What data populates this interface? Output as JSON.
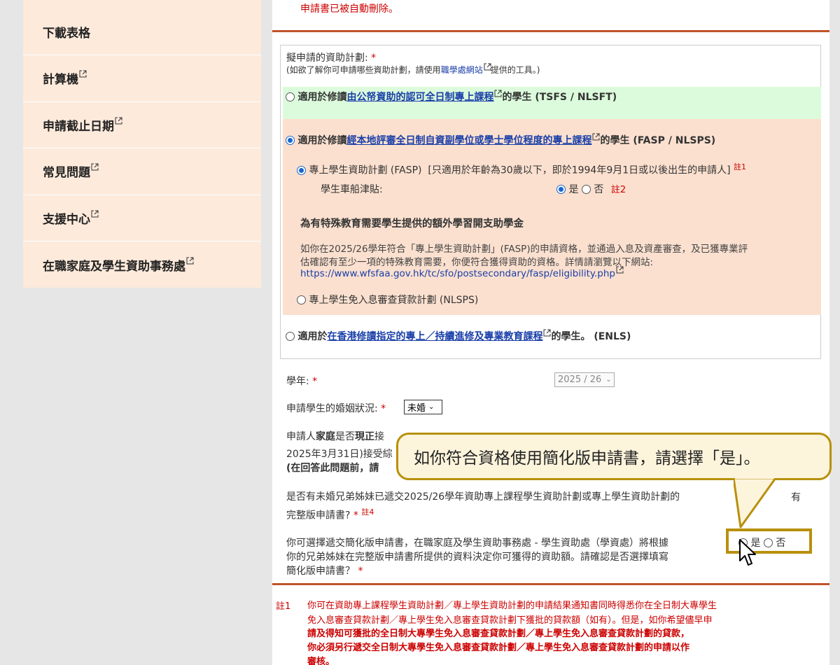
{
  "sidebar": {
    "items": [
      {
        "label": "下載表格",
        "external": false
      },
      {
        "label": "計算機",
        "external": true
      },
      {
        "label": "申請截止日期",
        "external": true
      },
      {
        "label": "常見問題",
        "external": true
      },
      {
        "label": "支援中心",
        "external": true
      },
      {
        "label": "在職家庭及學生資助事務處",
        "external": true
      }
    ]
  },
  "top_note": "申請書已被自動刪除。",
  "scheme": {
    "label": "擬申請的資助計劃:",
    "required": "*",
    "hint_prefix": "(如欲了解你可申請哪些資助計劃，請使用",
    "hint_link": "職學處網站",
    "hint_suffix": "提供的工具。)",
    "opt1_prefix": "適用於修讀",
    "opt1_link": "由公帑資助的認可全日制專上課程",
    "opt1_suffix": "的學生 (TSFS / NLSFT)",
    "opt2_prefix": "適用於修讀",
    "opt2_link": "經本地評審全日制自資副學位或學士學位程度的專上課程",
    "opt2_suffix": "的學生 (FASP / NLSPS)",
    "fasp_label": "專上學生資助計劃 (FASP)",
    "fasp_note": "[只適用於年齡為30歲以下，即於1994年9月1日或以後出生的申請人]",
    "note1": "註1",
    "travel_label": "學生車船津貼:",
    "yes": "是",
    "no": "否",
    "note2": "註2",
    "sen_title": "為有特殊教育需要學生提供的額外學習開支助學金",
    "sen_text1": "如你在2025/26學年符合「專上學生資助計劃」(FASP)的申請資格，並通過入息及資產審查，及已獲專業評",
    "sen_text2": "估確認有至少一項的特殊教育需要，你便符合獲得資助的資格。詳情請瀏覽以下網站:",
    "sen_url": "https://www.wfsfaa.gov.hk/tc/sfo/postsecondary/fasp/eligibility.php",
    "nlsps_label": "專上學生免入息審查貸款計劃 (NLSPS)",
    "opt3_prefix": "適用於",
    "opt3_link": "在香港修讀指定的專上／持續進修及專業教育課程",
    "opt3_suffix": "的學生。 (ENLS)"
  },
  "academic_year": {
    "label": "學年:",
    "required": "*",
    "value": "2025 / 26"
  },
  "marital": {
    "label": "申請學生的婚姻狀況:",
    "required": "*",
    "value": "未婚"
  },
  "family_q": {
    "line1_a": "申請人",
    "line1_b": "家庭",
    "line1_c": "是否",
    "line1_d": "現正",
    "line1_e": "接",
    "line2": "2025年3月31日)接受綜",
    "line3": "(在回答此問題前，請"
  },
  "sibling_q": {
    "line1": "是否有未婚兄弟姊妹已遞交2025/26學年資助專上課程學生資助計劃或專上學生資助計劃的",
    "line2": "完整版申請書?",
    "required": "*",
    "note": "註4",
    "no_partial": "有"
  },
  "simplified_q": {
    "line1": "你可選擇遞交簡化版申請書，在職家庭及學生資助事務處 - 學生資助處（學資處）將根據",
    "line2": "你的兄弟姊妹在完整版申請書所提供的資料決定你可獲得的資助額。請確認是否選擇填寫",
    "line3": "簡化版申請書？",
    "required": "*",
    "yes": "是",
    "no": "否"
  },
  "callout": {
    "text": "如你符合資格使用簡化版申請書，請選擇「是」。"
  },
  "footnote": {
    "label": "註1",
    "line1": "你可在資助專上課程學生資助計劃／專上學生資助計劃的申請結果通知書同時得悉你在全日制大專學生",
    "line2": "免入息審查貸款計劃／專上學生免入息審查貸款計劃下獲批的貸款額（如有）。但是，如你希望儘早申",
    "line3": "請及得知可獲批的全日制大專學生免入息審查貸款計劃／專上學生免入息審查貸款計劃的貸款，",
    "line4": "你必須另行遞交全日制大專學生免入息審查貸款計劃／專上學生免入息審查貸款計劃的申請以作",
    "line5": "審核。"
  },
  "colors": {
    "accent_rule": "#c0532a",
    "callout_border": "#b8900c",
    "link": "#1a3fa8",
    "required": "#cc0000"
  }
}
